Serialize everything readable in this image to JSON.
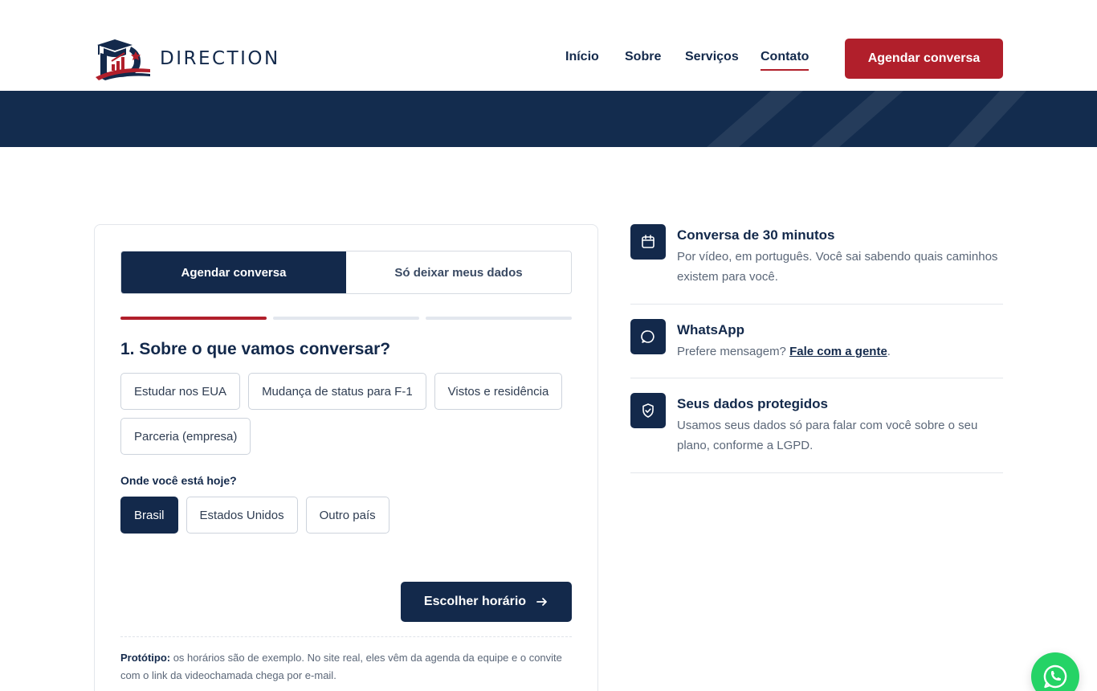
{
  "brand": {
    "name": "DIRECTION",
    "colors": {
      "navy": "#13294b",
      "red": "#b11f2b",
      "whatsapp": "#25d366"
    }
  },
  "nav": {
    "items": [
      {
        "label": "Início"
      },
      {
        "label": "Sobre"
      },
      {
        "label": "Serviços"
      },
      {
        "label": "Contato",
        "active": true
      }
    ],
    "cta_label": "Agendar conversa"
  },
  "form": {
    "tabs": [
      {
        "label": "Agendar conversa",
        "active": true
      },
      {
        "label": "Só deixar meus dados",
        "active": false
      }
    ],
    "progress": {
      "current_step": 1,
      "total_steps": 3
    },
    "question_title": "1. Sobre o que vamos conversar?",
    "topics": [
      "Estudar nos EUA",
      "Mudança de status para F-1",
      "Vistos e residência",
      "Parceria (empresa)"
    ],
    "location_label": "Onde você está hoje?",
    "locations": [
      {
        "label": "Brasil",
        "selected": true
      },
      {
        "label": "Estados Unidos",
        "selected": false
      },
      {
        "label": "Outro país",
        "selected": false
      }
    ],
    "next_button": "Escolher horário",
    "note_strong": "Protótipo:",
    "note_text": " os horários são de exemplo. No site real, eles vêm da agenda da equipe e o convite com o link da videochamada chega por e-mail."
  },
  "info": {
    "items": [
      {
        "icon": "calendar-icon",
        "title": "Conversa de 30 minutos",
        "text": "Por vídeo, em português. Você sai sabendo quais caminhos existem para você."
      },
      {
        "icon": "chat-icon",
        "title": "WhatsApp",
        "text_before": "Prefere mensagem? ",
        "link": "Fale com a gente",
        "text_after": "."
      },
      {
        "icon": "shield-check-icon",
        "title": "Seus dados protegidos",
        "text": "Usamos seus dados só para falar com você sobre o seu plano, conforme a LGPD."
      }
    ]
  }
}
